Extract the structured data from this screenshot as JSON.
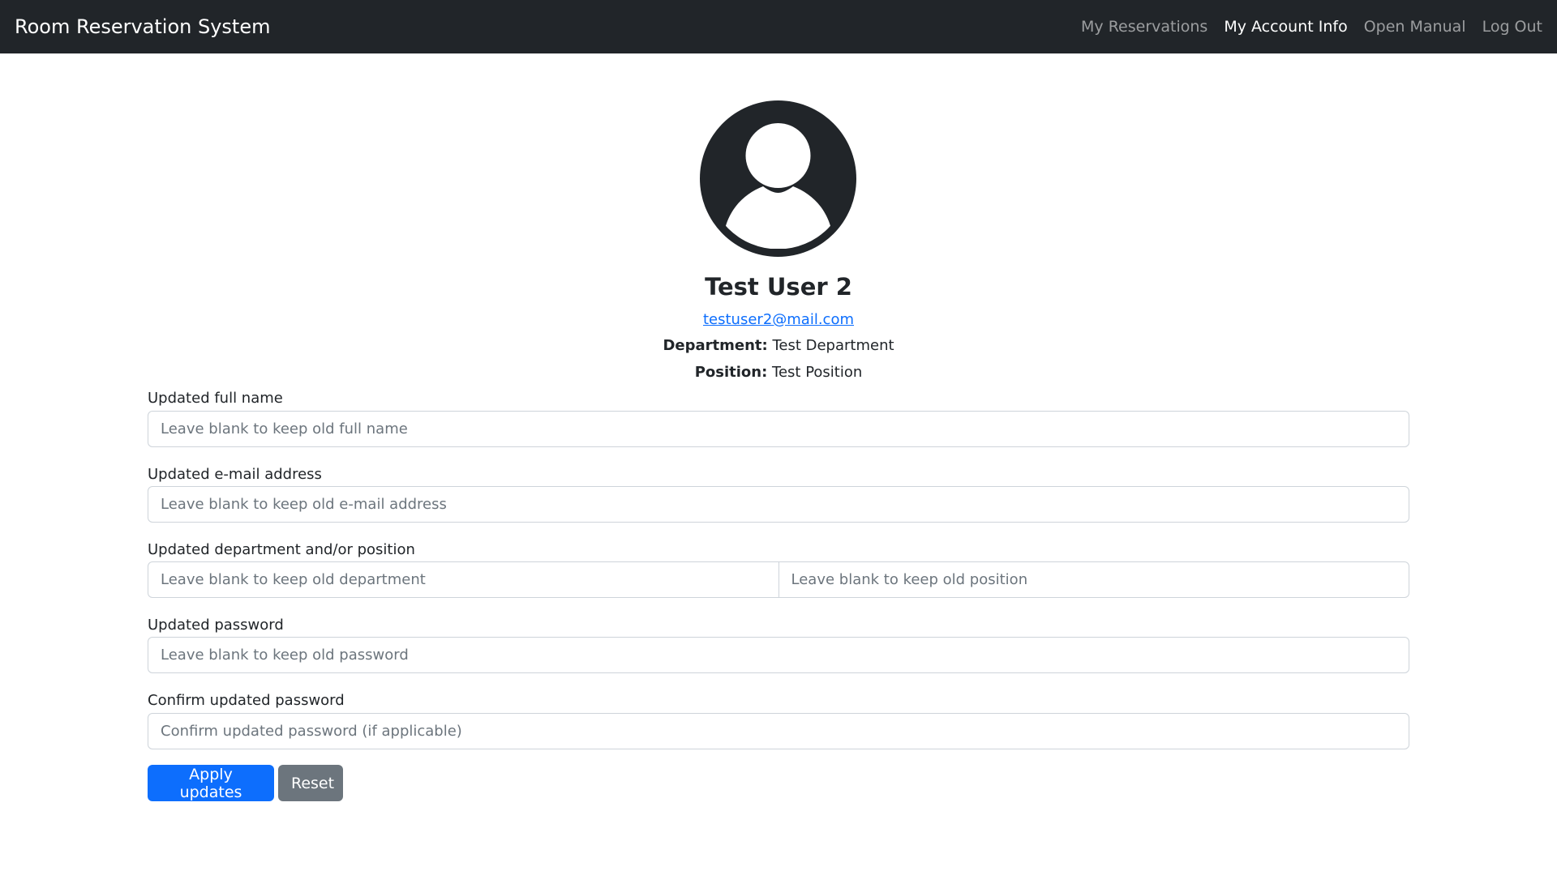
{
  "navbar": {
    "brand": "Room Reservation System",
    "links": [
      {
        "label": "My Reservations",
        "active": false
      },
      {
        "label": "My Account Info",
        "active": true
      },
      {
        "label": "Open Manual",
        "active": false
      },
      {
        "label": "Log Out",
        "active": false
      }
    ]
  },
  "profile": {
    "avatar_icon": "person-circle-icon",
    "name": "Test User 2",
    "email": "testuser2@mail.com",
    "department_label": "Department:",
    "department_value": "Test Department",
    "position_label": "Position:",
    "position_value": "Test Position"
  },
  "form": {
    "full_name": {
      "label": "Updated full name",
      "value": "",
      "placeholder": "Leave blank to keep old full name"
    },
    "email": {
      "label": "Updated e-mail address",
      "value": "",
      "placeholder": "Leave blank to keep old e-mail address"
    },
    "dept_position": {
      "label": "Updated department and/or position",
      "department_placeholder": "Leave blank to keep old department",
      "position_placeholder": "Leave blank to keep old position"
    },
    "password": {
      "label": "Updated password",
      "value": "",
      "placeholder": "Leave blank to keep old password"
    },
    "confirm_password": {
      "label": "Confirm updated password",
      "value": "",
      "placeholder": "Confirm updated password (if applicable)"
    },
    "apply_label": "Apply updates",
    "reset_label": "Reset"
  },
  "colors": {
    "navbar_bg": "#212529",
    "primary": "#0d6efd",
    "secondary": "#6c757d"
  }
}
